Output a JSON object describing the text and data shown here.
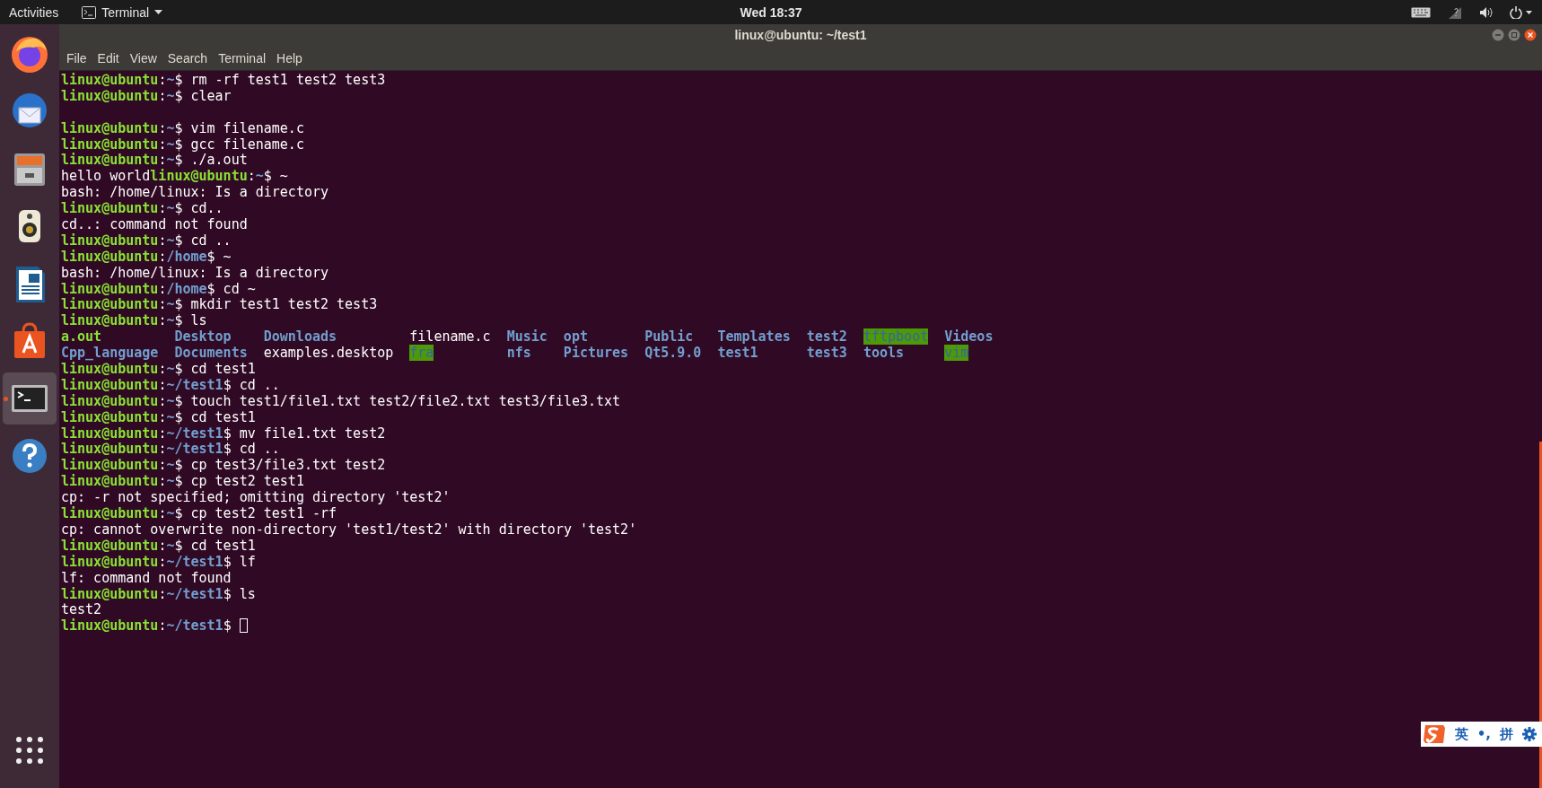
{
  "top_bar": {
    "activities": "Activities",
    "app_menu": "Terminal",
    "clock": "Wed 18:37"
  },
  "dock": {
    "items": [
      {
        "kind": "firefox",
        "selected": false
      },
      {
        "kind": "mail",
        "selected": false
      },
      {
        "kind": "files",
        "selected": false
      },
      {
        "kind": "speaker",
        "selected": false
      },
      {
        "kind": "writer",
        "selected": false
      },
      {
        "kind": "store",
        "selected": false
      },
      {
        "kind": "terminal",
        "selected": true
      },
      {
        "kind": "help",
        "selected": false
      }
    ]
  },
  "window": {
    "title": "linux@ubuntu: ~/test1",
    "menu": [
      "File",
      "Edit",
      "View",
      "Search",
      "Terminal",
      "Help"
    ]
  },
  "terminal": {
    "lines": [
      {
        "kind": "prompt",
        "user": "linux@ubuntu",
        "sep": ":",
        "path": "~",
        "tail": "$ rm -rf test1 test2 test3"
      },
      {
        "kind": "prompt",
        "user": "linux@ubuntu",
        "sep": ":",
        "path": "~",
        "tail": "$ clear"
      },
      {
        "kind": "blank"
      },
      {
        "kind": "prompt",
        "user": "linux@ubuntu",
        "sep": ":",
        "path": "~",
        "tail": "$ vim filename.c"
      },
      {
        "kind": "prompt",
        "user": "linux@ubuntu",
        "sep": ":",
        "path": "~",
        "tail": "$ gcc filename.c"
      },
      {
        "kind": "prompt",
        "user": "linux@ubuntu",
        "sep": ":",
        "path": "~",
        "tail": "$ ./a.out"
      },
      {
        "kind": "prompt",
        "pre": "hello world",
        "user": "linux@ubuntu",
        "sep": ":",
        "path": "~",
        "tail": "$ ~"
      },
      {
        "kind": "output",
        "text": "bash: /home/linux: Is a directory"
      },
      {
        "kind": "prompt",
        "user": "linux@ubuntu",
        "sep": ":",
        "path": "~",
        "tail": "$ cd.."
      },
      {
        "kind": "output",
        "text": "cd..: command not found"
      },
      {
        "kind": "prompt",
        "user": "linux@ubuntu",
        "sep": ":",
        "path": "~",
        "tail": "$ cd .."
      },
      {
        "kind": "prompt",
        "user": "linux@ubuntu",
        "sep": ":",
        "path": "/home",
        "tail": "$ ~"
      },
      {
        "kind": "output",
        "text": "bash: /home/linux: Is a directory"
      },
      {
        "kind": "prompt",
        "user": "linux@ubuntu",
        "sep": ":",
        "path": "/home",
        "tail": "$ cd ~"
      },
      {
        "kind": "prompt",
        "user": "linux@ubuntu",
        "sep": ":",
        "path": "~",
        "tail": "$ mkdir test1 test2 test3"
      },
      {
        "kind": "prompt",
        "user": "linux@ubuntu",
        "sep": ":",
        "path": "~",
        "tail": "$ ls"
      },
      {
        "kind": "listing",
        "rows": [
          [
            {
              "text": "a.out",
              "kind": "exec"
            },
            {
              "text": "Desktop",
              "kind": "dir"
            },
            {
              "text": "Downloads",
              "kind": "dir"
            },
            {
              "text": "filename.c",
              "kind": "file"
            },
            {
              "text": "Music",
              "kind": "dir"
            },
            {
              "text": "opt",
              "kind": "dir"
            },
            {
              "text": "Public",
              "kind": "dir"
            },
            {
              "text": "Templates",
              "kind": "dir"
            },
            {
              "text": "test2",
              "kind": "dir"
            },
            {
              "text": "tftpboot",
              "kind": "shared"
            },
            {
              "text": "Videos",
              "kind": "dir"
            }
          ],
          [
            {
              "text": "Cpp_language",
              "kind": "dir"
            },
            {
              "text": "Documents",
              "kind": "dir"
            },
            {
              "text": "examples.desktop",
              "kind": "file"
            },
            {
              "text": "fra",
              "kind": "shared"
            },
            {
              "text": "nfs",
              "kind": "dir"
            },
            {
              "text": "Pictures",
              "kind": "dir"
            },
            {
              "text": "Qt5.9.0",
              "kind": "dir"
            },
            {
              "text": "test1",
              "kind": "dir"
            },
            {
              "text": "test3",
              "kind": "dir"
            },
            {
              "text": "tools",
              "kind": "dir"
            },
            {
              "text": "vim",
              "kind": "shared"
            }
          ]
        ]
      },
      {
        "kind": "prompt",
        "user": "linux@ubuntu",
        "sep": ":",
        "path": "~",
        "tail": "$ cd test1"
      },
      {
        "kind": "prompt",
        "user": "linux@ubuntu",
        "sep": ":",
        "path": "~/test1",
        "tail": "$ cd .."
      },
      {
        "kind": "prompt",
        "user": "linux@ubuntu",
        "sep": ":",
        "path": "~",
        "tail": "$ touch test1/file1.txt test2/file2.txt test3/file3.txt"
      },
      {
        "kind": "prompt",
        "user": "linux@ubuntu",
        "sep": ":",
        "path": "~",
        "tail": "$ cd test1"
      },
      {
        "kind": "prompt",
        "user": "linux@ubuntu",
        "sep": ":",
        "path": "~/test1",
        "tail": "$ mv file1.txt test2"
      },
      {
        "kind": "prompt",
        "user": "linux@ubuntu",
        "sep": ":",
        "path": "~/test1",
        "tail": "$ cd .."
      },
      {
        "kind": "prompt",
        "user": "linux@ubuntu",
        "sep": ":",
        "path": "~",
        "tail": "$ cp test3/file3.txt test2"
      },
      {
        "kind": "prompt",
        "user": "linux@ubuntu",
        "sep": ":",
        "path": "~",
        "tail": "$ cp test2 test1"
      },
      {
        "kind": "output",
        "text": "cp: -r not specified; omitting directory 'test2'"
      },
      {
        "kind": "prompt",
        "user": "linux@ubuntu",
        "sep": ":",
        "path": "~",
        "tail": "$ cp test2 test1 -rf"
      },
      {
        "kind": "output",
        "text": "cp: cannot overwrite non-directory 'test1/test2' with directory 'test2'"
      },
      {
        "kind": "prompt",
        "user": "linux@ubuntu",
        "sep": ":",
        "path": "~",
        "tail": "$ cd test1"
      },
      {
        "kind": "prompt",
        "user": "linux@ubuntu",
        "sep": ":",
        "path": "~/test1",
        "tail": "$ lf"
      },
      {
        "kind": "output",
        "text": "lf: command not found"
      },
      {
        "kind": "prompt",
        "user": "linux@ubuntu",
        "sep": ":",
        "path": "~/test1",
        "tail": "$ ls"
      },
      {
        "kind": "output",
        "text": "test2"
      },
      {
        "kind": "prompt",
        "user": "linux@ubuntu",
        "sep": ":",
        "path": "~/test1",
        "tail": "$ ",
        "cursor": true
      }
    ]
  },
  "ime": {
    "mode": "英",
    "punct": "•,",
    "layout": "拼"
  }
}
